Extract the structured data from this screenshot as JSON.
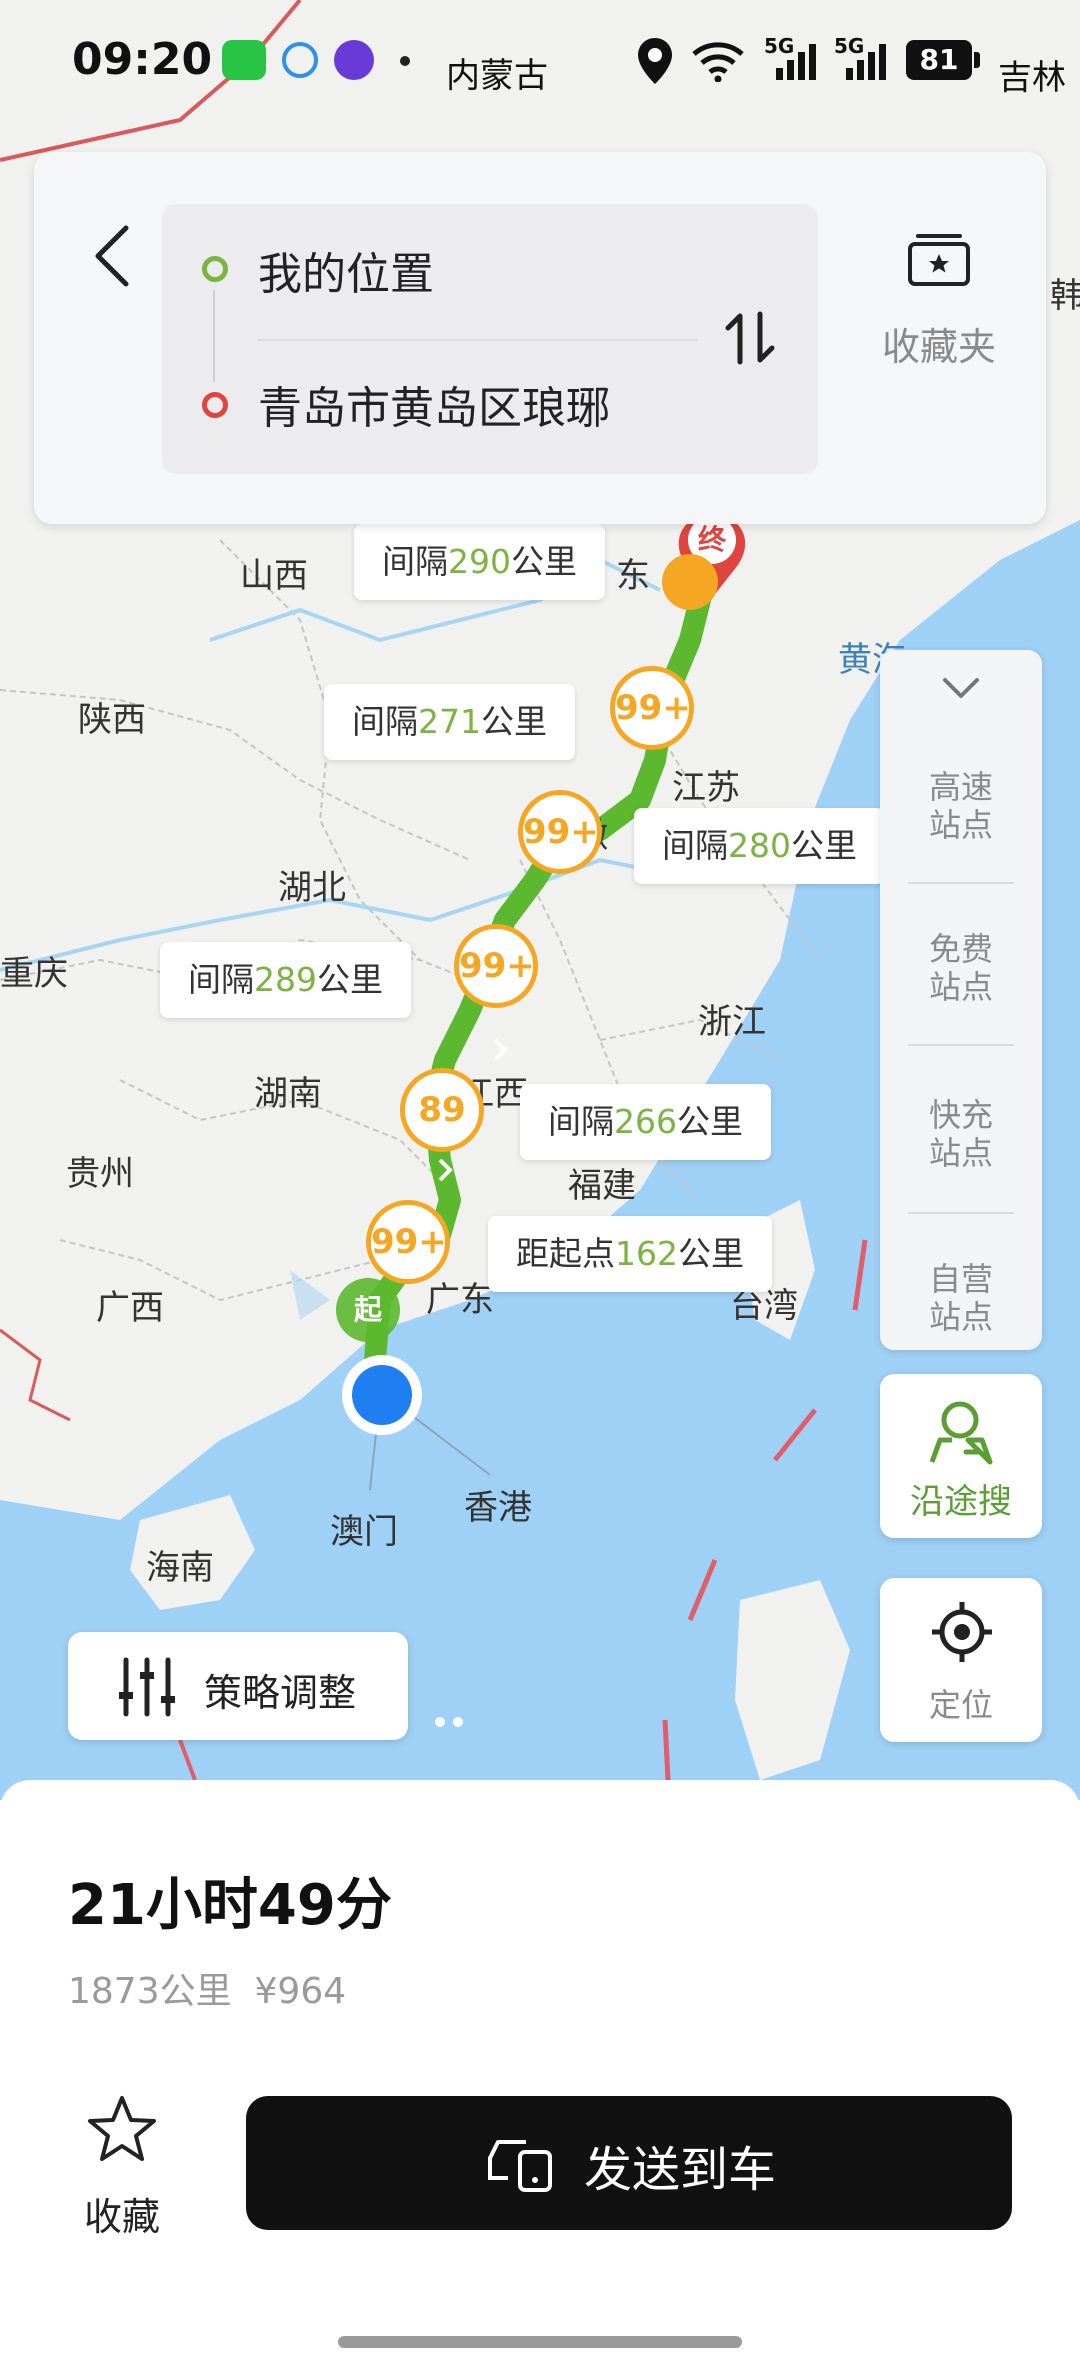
{
  "status_bar": {
    "time": "09:20",
    "location_text": "内蒙古",
    "battery": "81",
    "network_1": "5G",
    "network_2": "5G"
  },
  "route": {
    "origin": "我的位置",
    "destination": "青岛市黄岛区琅琊",
    "favorites_label": "收藏夹"
  },
  "map": {
    "places": [
      {
        "name": "山西"
      },
      {
        "name": "陕西"
      },
      {
        "name": "湖北"
      },
      {
        "name": "重庆"
      },
      {
        "name": "湖南"
      },
      {
        "name": "贵州"
      },
      {
        "name": "广西"
      },
      {
        "name": "江苏"
      },
      {
        "name": "浙江"
      },
      {
        "name": "安徽"
      },
      {
        "name": "江西"
      },
      {
        "name": "福建"
      },
      {
        "name": "台湾"
      },
      {
        "name": "广东"
      },
      {
        "name": "澳门"
      },
      {
        "name": "香港"
      },
      {
        "name": "海南"
      },
      {
        "name": "黄海"
      },
      {
        "name": "东"
      },
      {
        "name": "韩"
      },
      {
        "name": "吉林"
      }
    ],
    "callouts": [
      {
        "prefix": "间隔",
        "value": "290",
        "suffix": "公里"
      },
      {
        "prefix": "间隔",
        "value": "271",
        "suffix": "公里"
      },
      {
        "prefix": "间隔",
        "value": "280",
        "suffix": "公里"
      },
      {
        "prefix": "间隔",
        "value": "289",
        "suffix": "公里"
      },
      {
        "prefix": "间隔",
        "value": "266",
        "suffix": "公里"
      },
      {
        "prefix": "距起点",
        "value": "162",
        "suffix": "公里"
      }
    ],
    "stations": [
      "99+",
      "99+",
      "99+",
      "89",
      "99+"
    ],
    "start_marker": "起",
    "end_marker": "终",
    "route_color": "#5cb82e",
    "station_color": "#f5a623"
  },
  "side_panel": {
    "items": [
      "高速\n站点",
      "免费\n站点",
      "快充\n站点",
      "自营\n站点"
    ],
    "along_route_search": "沿途搜",
    "locate": "定位"
  },
  "strategy_button": "策略调整",
  "summary": {
    "duration": "21小时49分",
    "distance_cost": "1873公里  ¥964",
    "favorite_label": "收藏",
    "send_to_car": "发送到车"
  }
}
